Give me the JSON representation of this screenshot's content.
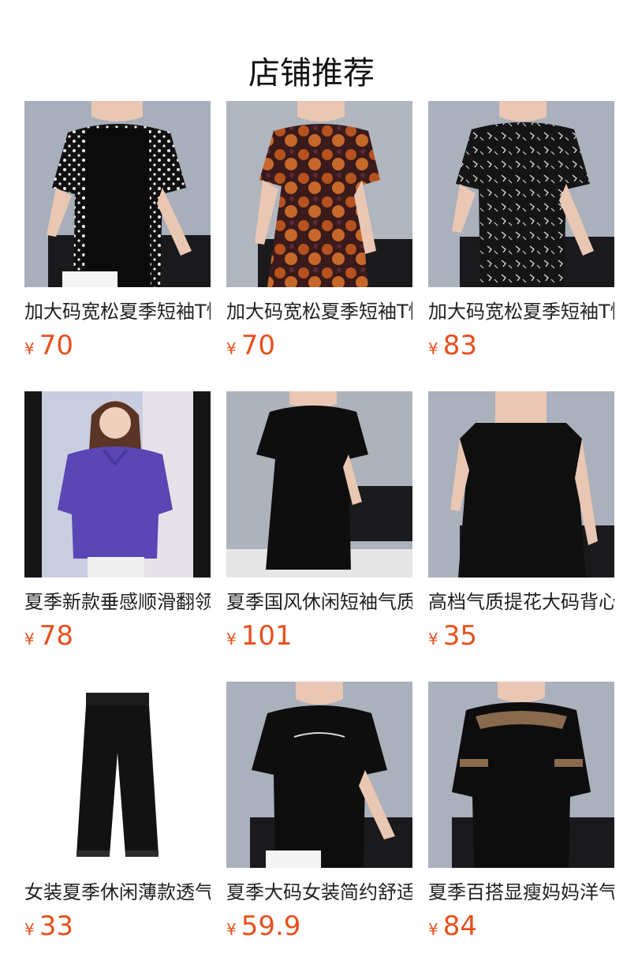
{
  "page": {
    "title": "店铺推荐"
  },
  "colors": {
    "price": "#e8501d",
    "title_text": "#111111",
    "product_text": "#222222"
  },
  "products": [
    {
      "name": "加大码宽松夏季短袖T恤",
      "currency": "¥",
      "price": "70",
      "image_icon": "polka-dot-top-photo"
    },
    {
      "name": "加大码宽松夏季短袖T恤",
      "currency": "¥",
      "price": "70",
      "image_icon": "floral-orange-top-photo"
    },
    {
      "name": "加大码宽松夏季短袖T恤",
      "currency": "¥",
      "price": "83",
      "image_icon": "print-black-top-photo"
    },
    {
      "name": "夏季新款垂感顺滑翻领",
      "currency": "¥",
      "price": "78",
      "image_icon": "purple-shirt-photo"
    },
    {
      "name": "夏季国风休闲短袖气质",
      "currency": "¥",
      "price": "101",
      "image_icon": "black-dress-photo"
    },
    {
      "name": "高档气质提花大码背心",
      "currency": "¥",
      "price": "35",
      "image_icon": "black-vest-photo"
    },
    {
      "name": "女装夏季休闲薄款透气",
      "currency": "¥",
      "price": "33",
      "image_icon": "black-pants-photo"
    },
    {
      "name": "夏季大码女装简约舒适",
      "currency": "¥",
      "price": "59.9",
      "image_icon": "black-hooded-top-photo"
    },
    {
      "name": "夏季百搭显瘦妈妈洋气",
      "currency": "¥",
      "price": "84",
      "image_icon": "embroidered-black-top-photo"
    }
  ]
}
